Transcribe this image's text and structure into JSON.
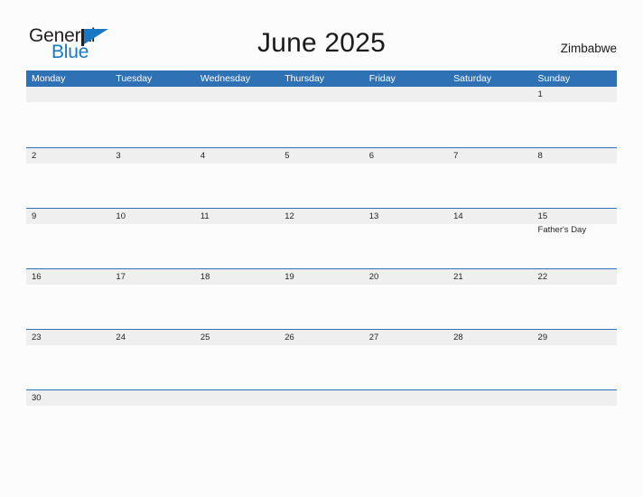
{
  "brand": {
    "name_top": "General",
    "name_bottom": "Blue",
    "flag_icon": "blue-flag-triangle-icon",
    "color_dark": "#231f20",
    "color_blue": "#1878c4"
  },
  "header": {
    "title": "June 2025",
    "region": "Zimbabwe"
  },
  "calendar": {
    "accent_color": "#2e72b5",
    "band_color": "#efefef",
    "day_names": [
      "Monday",
      "Tuesday",
      "Wednesday",
      "Thursday",
      "Friday",
      "Saturday",
      "Sunday"
    ],
    "weeks": [
      [
        {
          "date": "",
          "event": ""
        },
        {
          "date": "",
          "event": ""
        },
        {
          "date": "",
          "event": ""
        },
        {
          "date": "",
          "event": ""
        },
        {
          "date": "",
          "event": ""
        },
        {
          "date": "",
          "event": ""
        },
        {
          "date": "1",
          "event": ""
        }
      ],
      [
        {
          "date": "2",
          "event": ""
        },
        {
          "date": "3",
          "event": ""
        },
        {
          "date": "4",
          "event": ""
        },
        {
          "date": "5",
          "event": ""
        },
        {
          "date": "6",
          "event": ""
        },
        {
          "date": "7",
          "event": ""
        },
        {
          "date": "8",
          "event": ""
        }
      ],
      [
        {
          "date": "9",
          "event": ""
        },
        {
          "date": "10",
          "event": ""
        },
        {
          "date": "11",
          "event": ""
        },
        {
          "date": "12",
          "event": ""
        },
        {
          "date": "13",
          "event": ""
        },
        {
          "date": "14",
          "event": ""
        },
        {
          "date": "15",
          "event": "Father's Day"
        }
      ],
      [
        {
          "date": "16",
          "event": ""
        },
        {
          "date": "17",
          "event": ""
        },
        {
          "date": "18",
          "event": ""
        },
        {
          "date": "19",
          "event": ""
        },
        {
          "date": "20",
          "event": ""
        },
        {
          "date": "21",
          "event": ""
        },
        {
          "date": "22",
          "event": ""
        }
      ],
      [
        {
          "date": "23",
          "event": ""
        },
        {
          "date": "24",
          "event": ""
        },
        {
          "date": "25",
          "event": ""
        },
        {
          "date": "26",
          "event": ""
        },
        {
          "date": "27",
          "event": ""
        },
        {
          "date": "28",
          "event": ""
        },
        {
          "date": "29",
          "event": ""
        }
      ],
      [
        {
          "date": "30",
          "event": ""
        },
        {
          "date": "",
          "event": ""
        },
        {
          "date": "",
          "event": ""
        },
        {
          "date": "",
          "event": ""
        },
        {
          "date": "",
          "event": ""
        },
        {
          "date": "",
          "event": ""
        },
        {
          "date": "",
          "event": ""
        }
      ]
    ]
  }
}
